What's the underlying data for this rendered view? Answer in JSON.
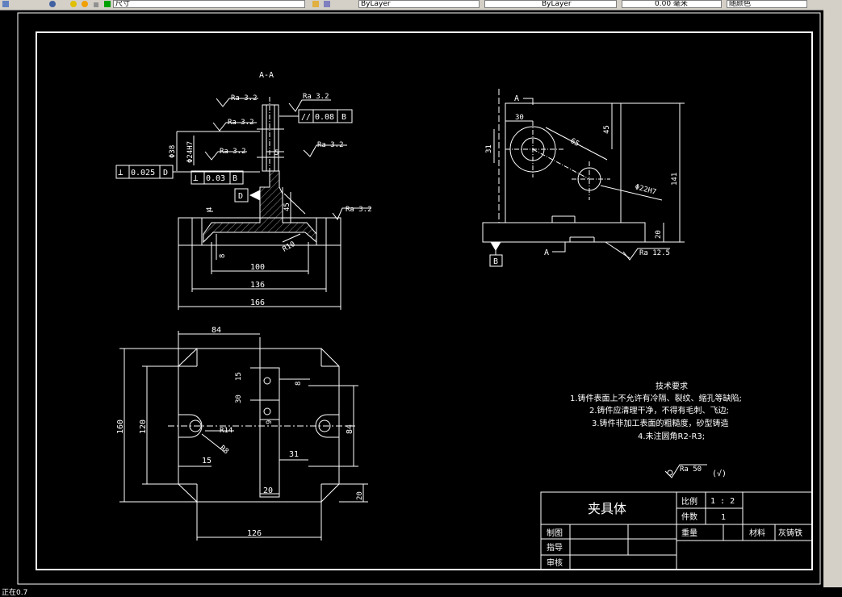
{
  "toolbar": {
    "field1": "尺寸",
    "field2": "ByLayer",
    "field3": "ByLayer",
    "field4": "0.00 毫米",
    "field5": "随颜色"
  },
  "status_text": "正在0.7",
  "drawing": {
    "section_label": "A-A",
    "roughness": {
      "r1": "Ra 3.2",
      "r2": "Ra 3.2",
      "r3": "Ra 3.2",
      "r4": "Ra 3.2",
      "r5": "Ra 3.2",
      "r6": "Ra 3.2",
      "r7": "Ra 12.5"
    },
    "tolerance": {
      "parallel_symbol": "//",
      "parallel_value": "0.08",
      "parallel_datum": "B",
      "perp1_symbol": "⊥",
      "perp1_value": "0.025",
      "perp1_datum": "D",
      "perp2_symbol": "⊥",
      "perp2_value": "0.03",
      "perp2_datum": "B"
    },
    "datum_d": "D",
    "datum_b": "B",
    "section_a1": "A",
    "section_a2": "A",
    "dims_section": {
      "d1": "Φ38",
      "d2": "Φ24H7",
      "d3": "5",
      "d4": "45",
      "d5": "4",
      "d6": "8",
      "d7": "R10",
      "d8": "100",
      "d9": "136",
      "d10": "166"
    },
    "dims_side": {
      "d1": "30",
      "d2": "31",
      "d3": "65",
      "d4": "45",
      "d5": "141",
      "d6": "Φ22H7",
      "d7": "20"
    },
    "dims_plan": {
      "d1": "84",
      "d2": "15",
      "d3": "30",
      "d4": "9",
      "d5": "8",
      "d6": "160",
      "d7": "120",
      "d8": "R14",
      "d9": "R8",
      "d10": "15",
      "d11": "84",
      "d12": "31",
      "d13": "20",
      "d14": "20",
      "d15": "126"
    },
    "notes": {
      "title": "技术要求",
      "n1": "1.铸件表面上不允许有冷隔、裂纹、缩孔等缺陷;",
      "n2": "2.铸件应清理干净，不得有毛刺、飞边;",
      "n3": "3.铸件非加工表面的粗糙度，砂型铸造",
      "n4": "4.未注圆角R2-R3;"
    },
    "general_roughness": "Ra 50",
    "general_roughness_mark": "(√)",
    "title_block": {
      "part_name": "夹具体",
      "scale_label": "比例",
      "scale_value": "1 : 2",
      "count_label": "件数",
      "count_value": "1",
      "weight_label": "重量",
      "material_label": "材料",
      "material_value": "灰铸铁",
      "drawn_label": "制图",
      "guide_label": "指导",
      "review_label": "审核"
    }
  }
}
